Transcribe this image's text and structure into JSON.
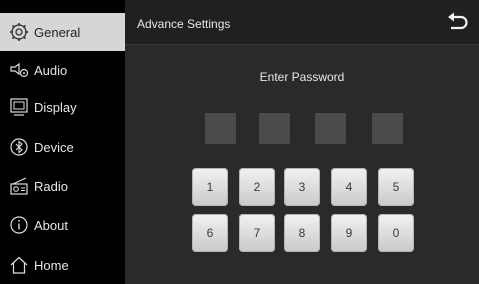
{
  "sidebar": {
    "items": [
      {
        "label": "General",
        "icon": "gear-icon",
        "active": true
      },
      {
        "label": "Audio",
        "icon": "speaker-icon"
      },
      {
        "label": "Display",
        "icon": "display-icon"
      },
      {
        "label": "Device",
        "icon": "bluetooth-icon"
      },
      {
        "label": "Radio",
        "icon": "radio-icon"
      },
      {
        "label": "About",
        "icon": "info-icon"
      },
      {
        "label": "Home",
        "icon": "home-icon"
      }
    ]
  },
  "header": {
    "title": "Advance Settings",
    "back_icon": "back-arrow-icon"
  },
  "password": {
    "prompt": "Enter Password"
  },
  "keypad": {
    "row1": [
      "1",
      "2",
      "3",
      "4",
      "5"
    ],
    "row2": [
      "6",
      "7",
      "8",
      "9",
      "0"
    ]
  },
  "colors": {
    "active_item_bg": "#d6d6d6",
    "pin_box": "#4b4b4b",
    "key_face": "#e2e2e2"
  }
}
